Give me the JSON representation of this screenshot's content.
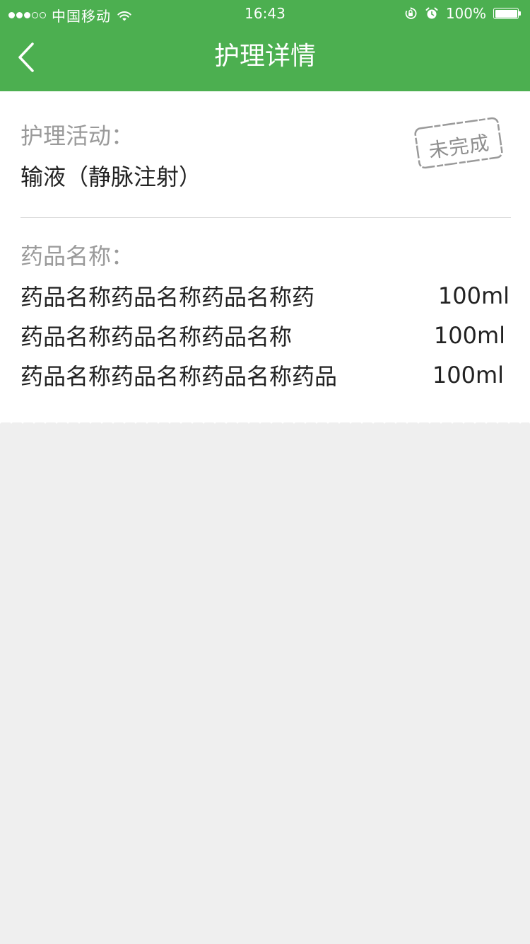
{
  "status_bar": {
    "carrier": "中国移动",
    "time": "16:43",
    "battery_percent": "100%",
    "battery_level": 1.0,
    "signal_bars_filled": 3,
    "signal_bars_total": 5
  },
  "nav": {
    "title": "护理详情",
    "back_icon": "chevron-left-icon"
  },
  "activity": {
    "label": "护理活动：",
    "value": "输液（静脉注射）",
    "status_stamp": "未完成"
  },
  "drugs": {
    "label": "药品名称：",
    "items": [
      {
        "name": "药品名称药品名称药品名称药",
        "amount": "100ml"
      },
      {
        "name": "药品名称药品名称药品名称",
        "amount": "100ml"
      },
      {
        "name": "药品名称药品名称药品名称药品",
        "amount": "100ml"
      }
    ]
  },
  "colors": {
    "header": "#4caf50",
    "background": "#efefef",
    "card": "#ffffff",
    "label_gray": "#9a9a9a",
    "text": "#222222"
  }
}
